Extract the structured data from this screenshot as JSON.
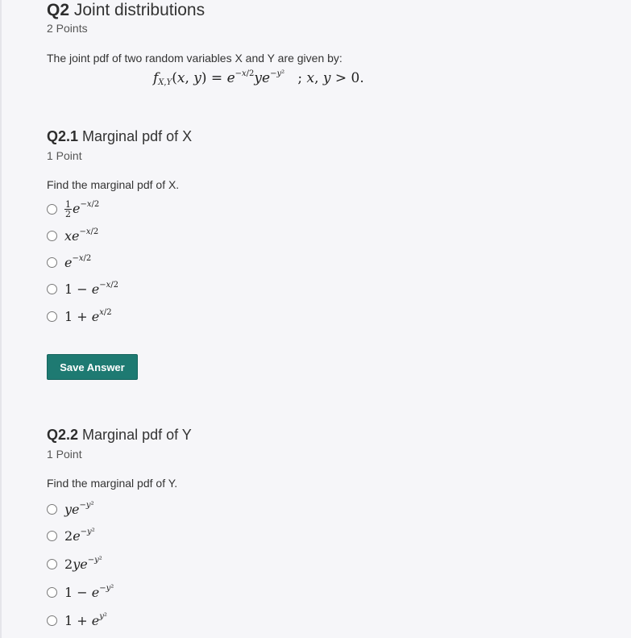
{
  "q2": {
    "number": "Q2",
    "title": "Joint distributions",
    "points": "2 Points",
    "prompt": "The joint pdf of two random variables X and Y are given by:"
  },
  "q2_1": {
    "number": "Q2.1",
    "title": "Marginal pdf of X",
    "points": "1 Point",
    "prompt": "Find the marginal pdf of X.",
    "save_label": "Save Answer"
  },
  "q2_2": {
    "number": "Q2.2",
    "title": "Marginal pdf of Y",
    "points": "1 Point",
    "prompt": "Find the marginal pdf of Y."
  },
  "colors": {
    "accent": "#1e7a72",
    "background": "#f6f6f9",
    "text": "#333333"
  }
}
